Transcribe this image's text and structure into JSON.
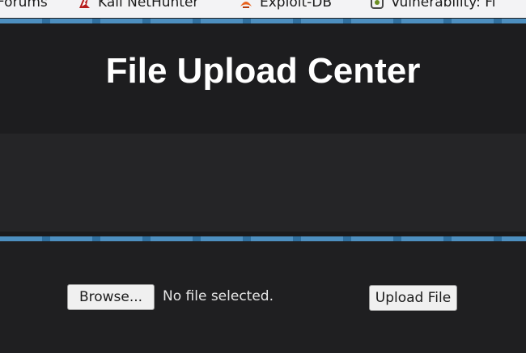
{
  "bookmarks": [
    {
      "label": "Forums",
      "icon": "forum-icon"
    },
    {
      "label": "Kali NetHunter",
      "icon": "kali-dragon-icon"
    },
    {
      "label": "Exploit-DB",
      "icon": "exploit-db-icon"
    },
    {
      "label": "Vulnerability: Fi",
      "icon": "page-icon"
    }
  ],
  "page": {
    "title": "File Upload Center"
  },
  "upload_form": {
    "browse_label": "Browse...",
    "file_status": "No file selected.",
    "submit_label": "Upload File"
  },
  "colors": {
    "accent_stripe": "#4d8fc0",
    "background": "#1e1e20",
    "title_text": "#ffffff"
  }
}
